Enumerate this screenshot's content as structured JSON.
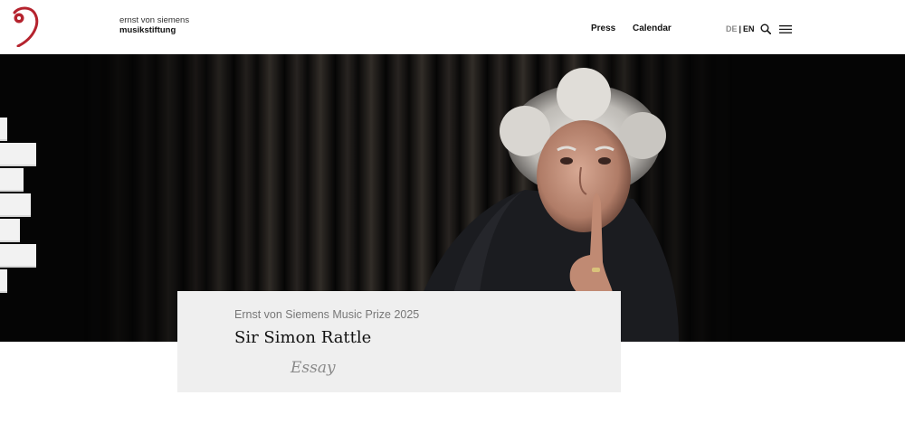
{
  "brand": {
    "line1": "ernst von siemens",
    "line2": "musikstiftung",
    "logo_icon": "clef-logo-icon",
    "accent_color": "#b5232e"
  },
  "nav": {
    "press": "Press",
    "calendar": "Calendar"
  },
  "lang": {
    "de": "DE",
    "separator": "|",
    "en": "EN"
  },
  "icons": {
    "search": "search-icon",
    "menu": "hamburger-menu-icon"
  },
  "hero": {
    "image": "portrait-photo"
  },
  "card": {
    "prize": "Ernst von Siemens Music Prize 2025",
    "name": "Sir Simon Rattle",
    "type": "Essay"
  }
}
